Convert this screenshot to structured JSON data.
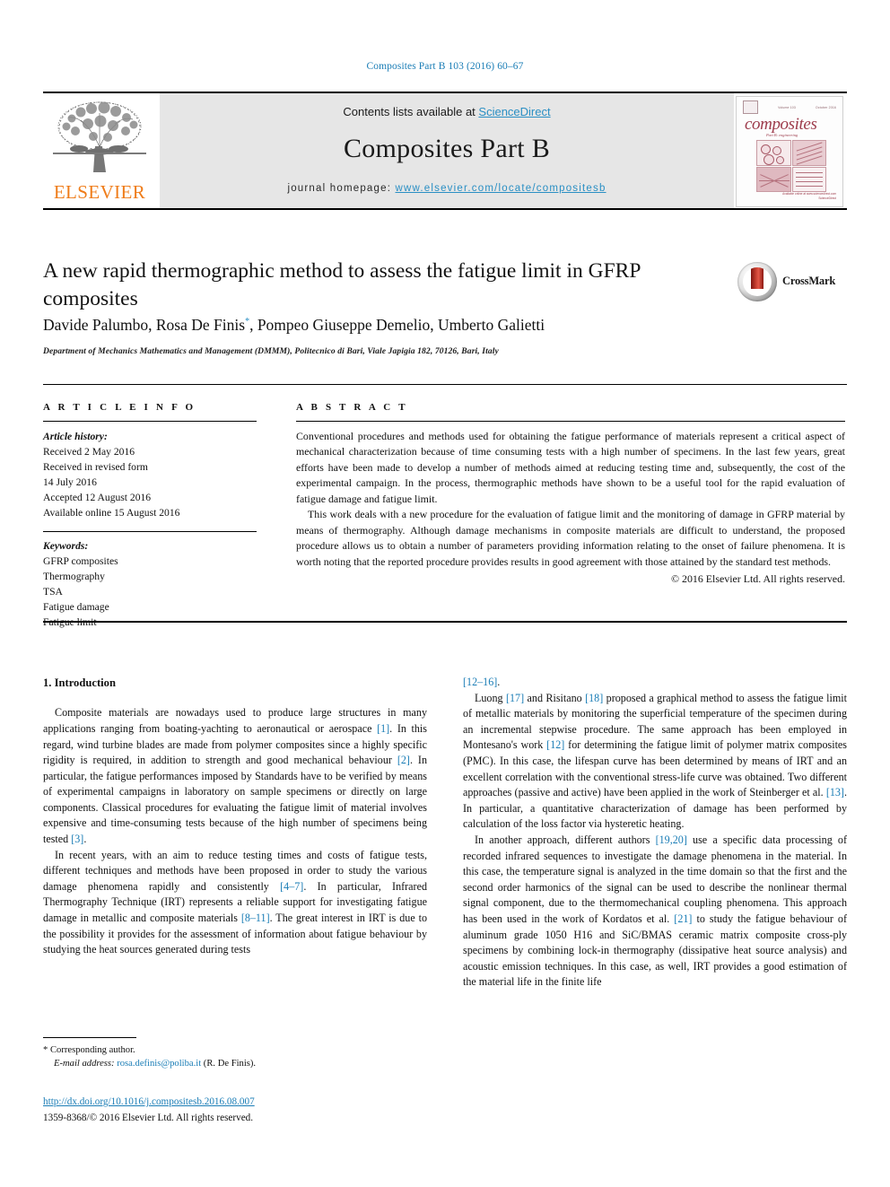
{
  "running_head": "Composites Part B 103 (2016) 60–67",
  "masthead": {
    "contents_prefix": "Contents lists available at ",
    "sciencedirect": "ScienceDirect",
    "journal_name": "Composites Part B",
    "homepage_label": "journal homepage: ",
    "homepage_url": "www.elsevier.com/locate/compositesb",
    "publisher_logo_text": "ELSEVIER",
    "cover": {
      "brand": "composites",
      "subtitle": "Part B: engineering",
      "top_left": "Volume 103",
      "top_right": "October 2016",
      "foot_line1": "Available online at www.sciencedirect.com",
      "foot_line2": "ScienceDirect"
    }
  },
  "article": {
    "title": "A new rapid thermographic method to assess the fatigue limit in GFRP composites",
    "crossmark_label": "CrossMark",
    "authors": "Davide Palumbo, Rosa De Finis",
    "authors_tail": ", Pompeo Giuseppe Demelio, Umberto Galietti",
    "corresponding_marker": "*",
    "affiliation": "Department of Mechanics Mathematics and Management (DMMM), Politecnico di Bari, Viale Japigia 182, 70126, Bari, Italy"
  },
  "article_info": {
    "heading": "A R T I C L E   I N F O",
    "history_label": "Article history:",
    "history": [
      "Received 2 May 2016",
      "Received in revised form",
      "14 July 2016",
      "Accepted 12 August 2016",
      "Available online 15 August 2016"
    ],
    "keywords_label": "Keywords:",
    "keywords": [
      "GFRP composites",
      "Thermography",
      "TSA",
      "Fatigue damage",
      "Fatigue limit"
    ]
  },
  "abstract": {
    "heading": "A B S T R A C T",
    "paragraph1": "Conventional procedures and methods used for obtaining the fatigue performance of materials represent a critical aspect of mechanical characterization because of time consuming tests with a high number of specimens. In the last few years, great efforts have been made to develop a number of methods aimed at reducing testing time and, subsequently, the cost of the experimental campaign. In the process, thermographic methods have shown to be a useful tool for the rapid evaluation of fatigue damage and fatigue limit.",
    "paragraph2": "This work deals with a new procedure for the evaluation of fatigue limit and the monitoring of damage in GFRP material by means of thermography. Although damage mechanisms in composite materials are difficult to understand, the proposed procedure allows us to obtain a number of parameters providing information relating to the onset of failure phenomena. It is worth noting that the reported procedure provides results in good agreement with those attained by the standard test methods.",
    "copyright": "© 2016 Elsevier Ltd. All rights reserved."
  },
  "body": {
    "section_heading": "1. Introduction",
    "left_p1_a": "Composite materials are nowadays used to produce large structures in many applications ranging from boating-yachting to aeronautical or aerospace ",
    "left_p1_r1": "[1]",
    "left_p1_b": ". In this regard, wind turbine blades are made from polymer composites since a highly specific rigidity is required, in addition to strength and good mechanical behaviour ",
    "left_p1_r2": "[2]",
    "left_p1_c": ". In particular, the fatigue performances imposed by Standards have to be verified by means of experimental campaigns in laboratory on sample specimens or directly on large components. Classical procedures for evaluating the fatigue limit of material involves expensive and time-consuming tests because of the high number of specimens being tested ",
    "left_p1_r3": "[3]",
    "left_p1_d": ".",
    "left_p2_a": "In recent years, with an aim to reduce testing times and costs of fatigue tests, different techniques and methods have been proposed in order to study the various damage phenomena rapidly and consistently ",
    "left_p2_r1": "[4–7]",
    "left_p2_b": ". In particular, Infrared Thermography Technique (IRT) represents a reliable support for investigating fatigue damage in metallic and composite materials ",
    "left_p2_r2": "[8–11]",
    "left_p2_c": ". The great interest in IRT is due to the possibility it provides for the assessment of information about fatigue behaviour by studying the heat sources generated during tests ",
    "right_p0_r1": "[12–16]",
    "right_p0_a": ".",
    "right_p1_a": "Luong ",
    "right_p1_r1": "[17]",
    "right_p1_b": " and Risitano ",
    "right_p1_r2": "[18]",
    "right_p1_c": " proposed a graphical method to assess the fatigue limit of metallic materials by monitoring the superficial temperature of the specimen during an incremental stepwise procedure. The same approach has been employed in Montesano's work ",
    "right_p1_r3": "[12]",
    "right_p1_d": " for determining the fatigue limit of polymer matrix composites (PMC). In this case, the lifespan curve has been determined by means of IRT and an excellent correlation with the conventional stress-life curve was obtained. Two different approaches (passive and active) have been applied in the work of Steinberger et al. ",
    "right_p1_r4": "[13]",
    "right_p1_e": ". In particular, a quantitative characterization of damage has been performed by calculation of the loss factor via hysteretic heating.",
    "right_p2_a": "In another approach, different authors ",
    "right_p2_r1": "[19,20]",
    "right_p2_b": " use a specific data processing of recorded infrared sequences to investigate the damage phenomena in the material. In this case, the temperature signal is analyzed in the time domain so that the first and the second order harmonics of the signal can be used to describe the nonlinear thermal signal component, due to the thermomechanical coupling phenomena. This approach has been used in the work of Kordatos et al. ",
    "right_p2_r2": "[21]",
    "right_p2_c": " to study the fatigue behaviour of aluminum grade 1050 H16 and SiC/BMAS ceramic matrix composite cross-ply specimens by combining lock-in thermography (dissipative heat source analysis) and acoustic emission techniques. In this case, as well, IRT provides a good estimation of the material life in the finite life"
  },
  "footer": {
    "corresponding_marker": "*",
    "corresponding_label": "Corresponding author.",
    "email_label": "E-mail address:",
    "email": "rosa.definis@poliba.it",
    "email_owner": "(R. De Finis).",
    "doi": "http://dx.doi.org/10.1016/j.compositesb.2016.08.007",
    "issn": "1359-8368/© 2016 Elsevier Ltd. All rights reserved."
  },
  "colors": {
    "link": "#1a7db6",
    "elsevier_orange": "#ef7c19",
    "masthead_band": "#e6e6e6"
  }
}
